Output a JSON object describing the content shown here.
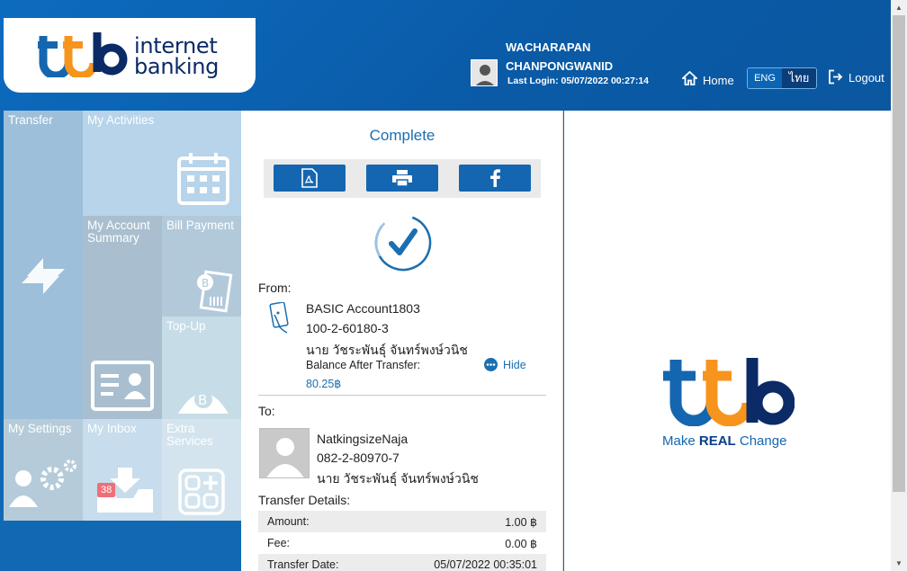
{
  "header": {
    "logo_text_line1": "internet",
    "logo_text_line2": "banking",
    "user_first": "WACHARAPAN",
    "user_last": "CHANPONGWANID",
    "last_login": "Last Login: 05/07/2022 00:27:14",
    "home_label": "Home",
    "lang_en": "ENG",
    "lang_th": "ไทย",
    "logout_label": "Logout"
  },
  "tiles": {
    "transfer": "Transfer",
    "my_activities": "My Activities",
    "my_account_summary": "My Account Summary",
    "bill_payment": "Bill Payment",
    "top_up": "Top-Up",
    "my_settings": "My Settings",
    "my_inbox": "My Inbox",
    "inbox_badge": "38",
    "extra_services": "Extra Services"
  },
  "result": {
    "status": "Complete",
    "from_label": "From:",
    "from_account_name": "BASIC Account1803",
    "from_account_no": "100-2-60180-3",
    "from_owner": "นาย วัชระพันธุ์ จันทร์พงษ์วนิช",
    "balance_label": "Balance After Transfer:",
    "balance_value": "80.25฿",
    "hide_label": "Hide",
    "to_label": "To:",
    "to_name": "NatkingsizeNaja",
    "to_account_no": "082-2-80970-7",
    "to_owner": "นาย วัชระพันธุ์ จันทร์พงษ์วนิช",
    "details_label": "Transfer Details:",
    "details": [
      {
        "label": "Amount:",
        "value": "1.00 ฿"
      },
      {
        "label": "Fee:",
        "value": "0.00 ฿"
      },
      {
        "label": "Transfer Date:",
        "value": "05/07/2022 00:35:01"
      }
    ]
  },
  "brand": {
    "tagline_pre": "Make ",
    "tagline_bold": "REAL",
    "tagline_post": " Change",
    "color_blue": "#1466b0",
    "color_orange": "#f7941d",
    "color_navy": "#0b2a66"
  }
}
